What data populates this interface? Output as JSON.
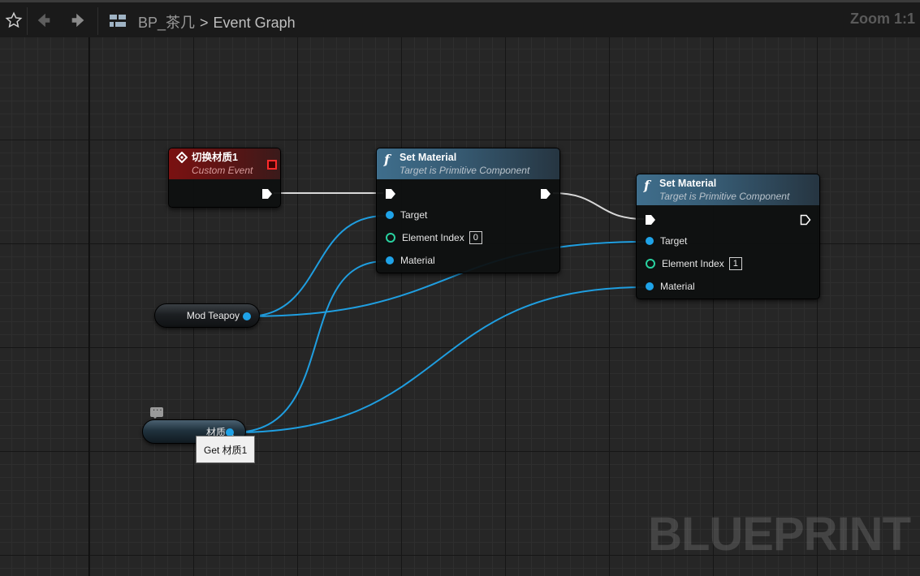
{
  "toolbar": {
    "breadcrumb_blueprint": "BP_茶几",
    "breadcrumb_separator": ">",
    "breadcrumb_graph": "Event Graph",
    "zoom": "Zoom 1:1"
  },
  "nodes": {
    "custom_event": {
      "title": "切换材质1",
      "subtitle": "Custom Event"
    },
    "set_material_1": {
      "title": "Set Material",
      "subtitle": "Target is Primitive Component",
      "pins": {
        "target": "Target",
        "element_index": "Element Index",
        "element_index_value": "0",
        "material": "Material"
      }
    },
    "set_material_2": {
      "title": "Set Material",
      "subtitle": "Target is Primitive Component",
      "pins": {
        "target": "Target",
        "element_index": "Element Index",
        "element_index_value": "1",
        "material": "Material"
      }
    },
    "var_mod_teapoy": {
      "label": "Mod Teapoy"
    },
    "var_material": {
      "label": "材质 1"
    }
  },
  "tooltip": "Get 材质1",
  "comment_bubble": "...",
  "watermark": "BLUEPRINT",
  "colors": {
    "exec_wire": "#d8d8d8",
    "object_wire": "#1f9ee0",
    "event_header": "#7a1111",
    "function_header": "#3f6e8c",
    "int_pin": "#29d2a0"
  },
  "icons": [
    "star-icon",
    "back-arrow-icon",
    "forward-arrow-icon",
    "blueprint-icon",
    "event-diamond-icon",
    "function-icon",
    "comment-icon"
  ]
}
